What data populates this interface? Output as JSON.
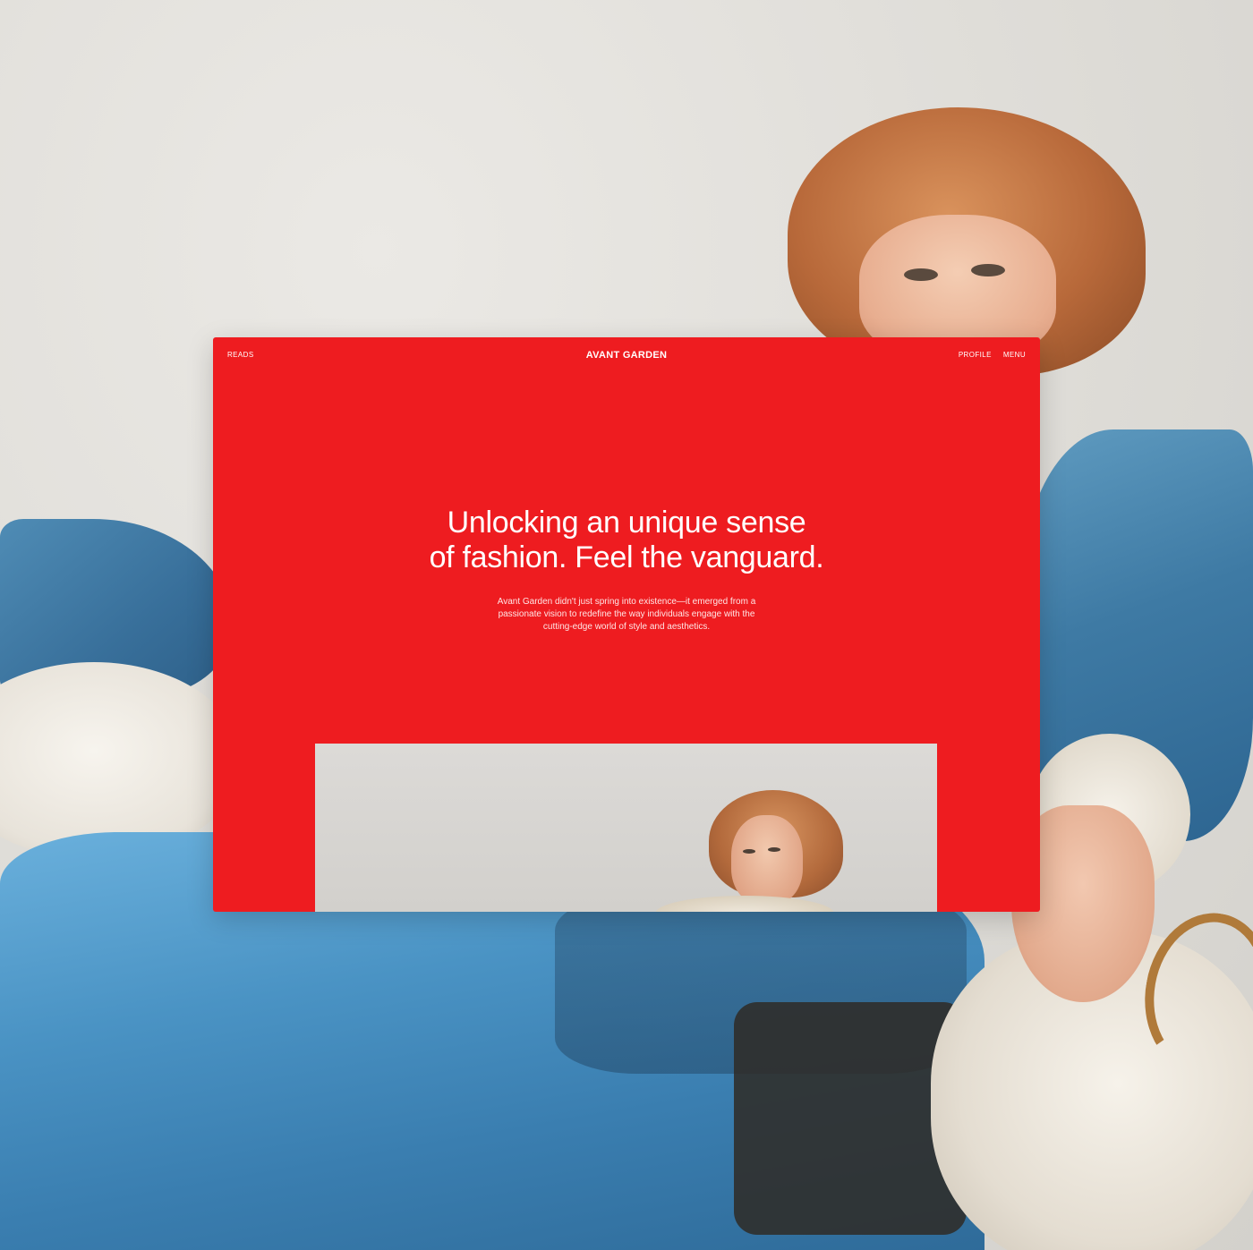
{
  "nav": {
    "reads_label": "READS",
    "logo_text": "AVANT GARDEN",
    "profile_label": "PROFILE",
    "menu_label": "MENU"
  },
  "hero": {
    "headline_line1": "Unlocking an unique sense",
    "headline_line2": "of fashion. Feel the vanguard.",
    "lede_line1": "Avant Garden didn't just spring into existence—it emerged from a",
    "lede_line2": "passionate vision to redefine the way individuals engage with the",
    "lede_line3": "cutting-edge world of style and aesthetics."
  },
  "colors": {
    "brand_red": "#ee1c20",
    "text_white": "#ffffff",
    "denim_blue": "#3a7eb0"
  }
}
